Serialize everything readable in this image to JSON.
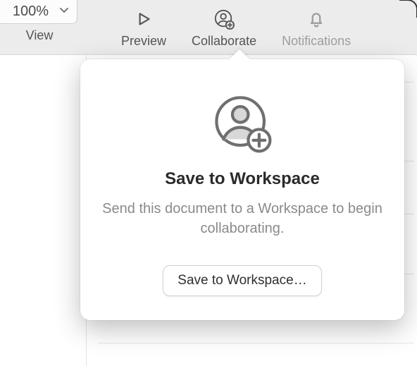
{
  "toolbar": {
    "zoom": {
      "value": "100%",
      "label": "View"
    },
    "preview": {
      "label": "Preview"
    },
    "collaborate": {
      "label": "Collaborate"
    },
    "notifications": {
      "label": "Notifications"
    }
  },
  "popover": {
    "title": "Save to Workspace",
    "description": "Send this document to a Workspace to begin collaborating.",
    "button": "Save to Workspace…"
  }
}
